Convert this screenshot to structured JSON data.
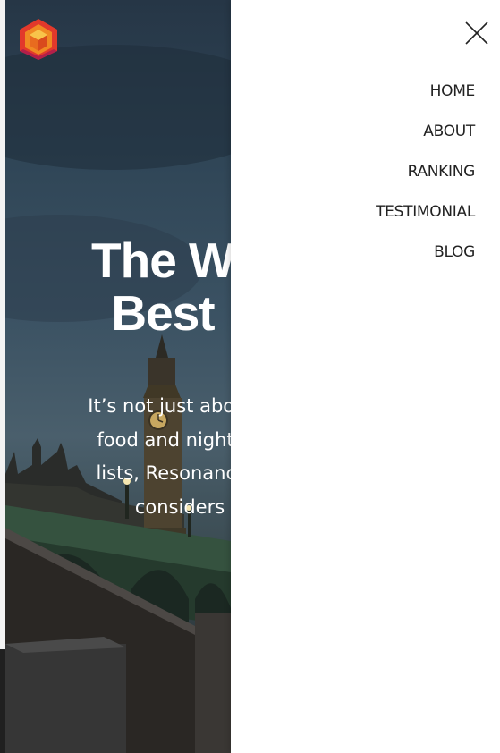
{
  "brand": {
    "logo_icon": "cube-hexagon-logo-icon",
    "colors": {
      "red": "#e2392b",
      "orange": "#f5a623",
      "magenta": "#b21f4a"
    }
  },
  "hero": {
    "title_line1": "The W",
    "title_line2": "Best",
    "text_lines": [
      "It’s not just about g",
      "food and nightlife",
      "lists, Resonance’s",
      "considers"
    ]
  },
  "menu": {
    "close_icon": "close-icon",
    "items": [
      {
        "label": "HOME"
      },
      {
        "label": "ABOUT"
      },
      {
        "label": "RANKING"
      },
      {
        "label": "TESTIMONIAL"
      },
      {
        "label": "BLOG"
      }
    ]
  }
}
